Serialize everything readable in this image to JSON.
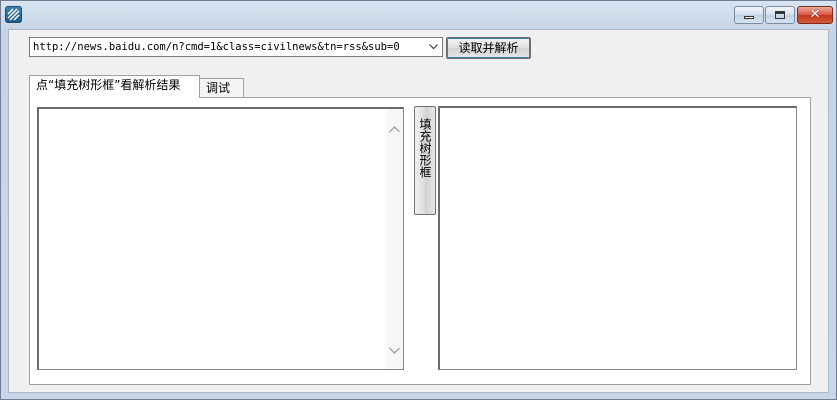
{
  "window": {
    "title": "",
    "caption_buttons": {
      "minimize": "minimize-icon",
      "maximize": "maximize-icon",
      "close": "✕"
    }
  },
  "toolbar": {
    "url_value": "http://news.baidu.com/n?cmd=1&class=civilnews&tn=rss&sub=0",
    "read_button_label": "读取并解析"
  },
  "tabs": [
    {
      "label": "点“填充树形框”看解析结果",
      "selected": true
    },
    {
      "label": "调试",
      "selected": false
    }
  ],
  "main": {
    "fill_tree_button_label": "填充树形框"
  }
}
